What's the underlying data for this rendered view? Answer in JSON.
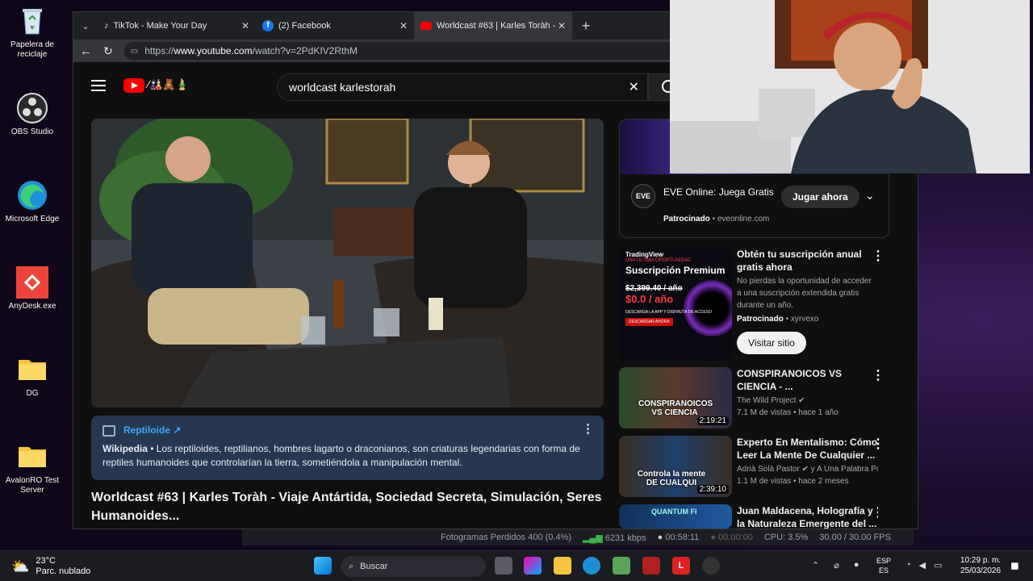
{
  "desktop": {
    "icons": [
      {
        "label": "Papelera de reciclaje",
        "icon": "recycle-bin-icon"
      },
      {
        "label": "OBS Studio",
        "icon": "obs-icon"
      },
      {
        "label": "Microsoft Edge",
        "icon": "edge-icon"
      },
      {
        "label": "AnyDesk.exe",
        "icon": "anydesk-icon"
      },
      {
        "label": "DG",
        "icon": "folder-icon"
      },
      {
        "label": "AvalonRO Test Server",
        "icon": "folder-icon"
      }
    ]
  },
  "browser": {
    "tabs": [
      {
        "label": "TikTok - Make Your Day",
        "icon": "tiktok-icon"
      },
      {
        "label": "(2) Facebook",
        "icon": "facebook-icon"
      },
      {
        "label": "Worldcast #63 | Karles Toràh - Viaj",
        "icon": "youtube-icon"
      }
    ],
    "url_prefix": "https://",
    "url_domain": "www.youtube.com",
    "url_path": "/watch?v=2PdKIV2RthM"
  },
  "youtube": {
    "search_value": "worldcast karlestorah",
    "info_card": {
      "link": "Reptiloide ↗",
      "source": "Wikipedia",
      "text": " • Los reptiloides, reptilianos, hombres lagarto o draconianos, son criaturas legendarias con forma de reptiles humanoides que controlarían la tierra, sometiéndola a manipulación mental."
    },
    "video_title": "Worldcast #63 | Karles Toràh - Viaje Antártida, Sociedad Secreta, Simulación, Seres Humanoides...",
    "sidebar": {
      "ad1": {
        "logo": "EVE",
        "title": "EVE Online: Juega Gratis",
        "sponsored": "Patrocinado",
        "domain": "eveonline.com",
        "button": "Jugar ahora"
      },
      "ad2": {
        "brand": "TradingView",
        "thumb_tag": "UNA ÚLTIMA OPORTUNIDAD",
        "thumb_title": "Suscripción Premium",
        "old_price": "$2,399.40 / año",
        "new_price": "$0.0 / año",
        "thumb_small": "DESCARGA LA APP Y DISFRUTA DE ACCESO",
        "thumb_btn": "DESCARGAR AHORA",
        "title": "Obtén tu suscripción anual gratis ahora",
        "desc": "No pierdas la oportunidad de acceder a una suscripción extendida gratis durante un año.",
        "sponsored": "Patrocinado",
        "advertiser": "xyrvexo",
        "button": "Visitar sitio"
      },
      "videos": [
        {
          "title": "CONSPIRANOICOS VS CIENCIA - ...",
          "channel": "The Wild Project",
          "stats": "7.1 M de vistas • hace 1 año",
          "duration": "2:19:21",
          "thumb_text": "CONSPIRANOICOS VS CIENCIA"
        },
        {
          "title": "Experto En Mentalismo: Cómo Leer La Mente De Cualquier ...",
          "channel": "Adrià Solà Pastor",
          "channel_extra": "y A Una Palabra Po...",
          "stats": "1.1 M de vistas • hace 2 meses",
          "duration": "2:39:10",
          "thumb_text": "Controla la mente DE CUALQUI"
        },
        {
          "title": "Juan Maldacena, Holografía y la Naturaleza Emergente del ...",
          "thumb_text": "QUANTUM FI"
        }
      ]
    }
  },
  "obs": {
    "dropped": "Fotogramas Perdidos 400 (0.4%)",
    "bitrate": "6231 kbps",
    "stream_time": "00:58:11",
    "rec_time": "00:00:00",
    "cpu": "CPU: 3.5%",
    "fps": "30.00 / 30.00 FPS"
  },
  "taskbar": {
    "temp": "23°C",
    "weather": "Parc. nublado",
    "search": "Buscar",
    "lang1": "ESP",
    "lang2": "ES",
    "time": "10:29 p. m.",
    "date": "25/03/2026"
  },
  "colors": {
    "yt_red": "#ff0000",
    "accent": "#3ea6ff",
    "infocard_bg": "#263850",
    "anydesk": "#ef443b"
  }
}
